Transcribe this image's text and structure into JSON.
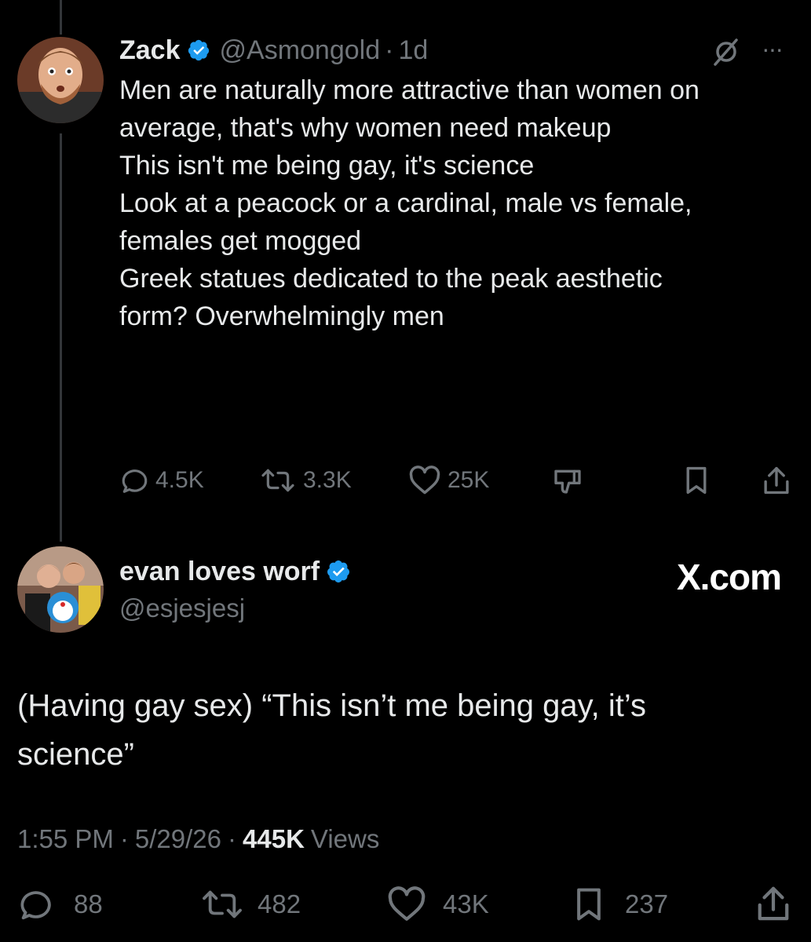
{
  "parent_tweet": {
    "display_name": "Zack",
    "handle": "@Asmongold",
    "separator": "·",
    "age": "1d",
    "more": "···",
    "lines": [
      "Men are naturally more attractive than women on",
      "average, that's why women need makeup",
      "",
      "This isn't me being gay, it's science",
      "",
      "Look at a peacock or a cardinal, male vs female,",
      "females get mogged",
      "",
      "Greek statues dedicated to the peak aesthetic",
      "form? Overwhelmingly men"
    ],
    "actions": {
      "replies": "4.5K",
      "reposts": "3.3K",
      "likes": "25K"
    }
  },
  "main_tweet": {
    "display_name": "evan loves worf",
    "handle": "@esjesjesj",
    "brand": "X.com",
    "lines": [
      "(Having gay sex) “This isn’t me being gay, it’s",
      "science”"
    ],
    "time": "1:55 PM",
    "dot": "·",
    "date": "5/29/26",
    "views_count": "445K",
    "views_label": "Views",
    "stats": {
      "replies": "88",
      "reposts": "482",
      "likes": "43K",
      "bookmarks": "237"
    }
  },
  "colors": {
    "background": "#000000",
    "text": "#e7e9ea",
    "muted": "#71767b",
    "verified": "#1d9bf0"
  },
  "icons": [
    "verified-badge-icon",
    "grok-icon",
    "more-icon",
    "reply-icon",
    "repost-icon",
    "like-icon",
    "dislike-icon",
    "bookmark-icon",
    "share-icon"
  ]
}
